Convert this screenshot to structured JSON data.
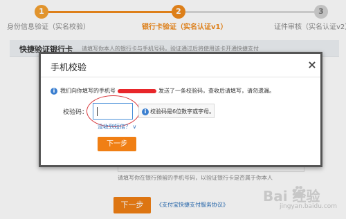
{
  "stepper": {
    "steps": [
      {
        "number": "1",
        "label": "身份信息验证（实名校验）"
      },
      {
        "number": "2",
        "label": "银行卡验证（实名认证v1）"
      },
      {
        "number": "3",
        "label": "证件审核（实名认证v2）"
      }
    ],
    "active_step": 2
  },
  "section": {
    "title": "快捷验证银行卡",
    "hint": "请填写你本人的银行卡与手机号码，验证通过后将使用该卡开通快捷支付"
  },
  "below": {
    "phone_hint": "请填写你在银行预留的手机号码，以验证银行卡是否属于你本人",
    "next_label": "下一步",
    "agreement_link": "《支付宝快捷支付服务协议》"
  },
  "modal": {
    "title": "手机校验",
    "close_glyph": "×",
    "info_prefix": "我们向你填写的手机号",
    "info_suffix": "发送了一条校验码，查收后请填写，请勿遗漏。",
    "code_label": "校验码：",
    "code_value": "",
    "tip": "校验码是6位数字或字母。",
    "no_sms_link": "没收到短信？",
    "next_label": "下一步"
  },
  "watermark": {
    "brand": "Bai 经验",
    "url": "jingyan.baidu.com"
  },
  "colors": {
    "accent": "#f08a1c",
    "link": "#2a6fb8",
    "info": "#3b7fd0",
    "inactive": "#d2d2d2"
  }
}
